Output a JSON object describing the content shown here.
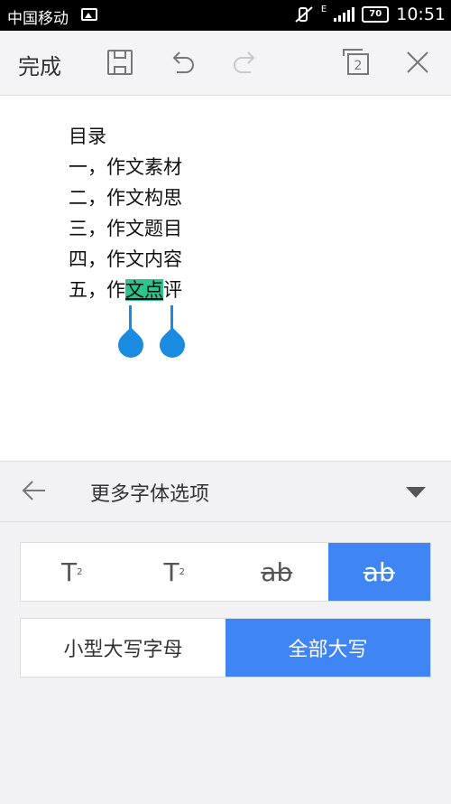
{
  "status_bar": {
    "carrier": "中国移动",
    "network": "E",
    "battery": "70",
    "time": "10:51"
  },
  "toolbar": {
    "done_label": "完成",
    "page_count": "2"
  },
  "document": {
    "lines": [
      {
        "text": "目录"
      },
      {
        "text": "一，作文素材"
      },
      {
        "text": "二，作文构思"
      },
      {
        "text": "三，作文题目"
      },
      {
        "text": "四，作文内容"
      }
    ],
    "last_line": {
      "before": "五，作",
      "selected": "文点",
      "after": "评"
    }
  },
  "font_options": {
    "title": "更多字体选项",
    "row1": [
      {
        "main": "T",
        "mark": "2",
        "kind": "superscript"
      },
      {
        "main": "T",
        "mark": "2",
        "kind": "subscript"
      },
      {
        "main": "ab",
        "kind": "strikethrough"
      },
      {
        "main": "ab",
        "kind": "double-strikethrough",
        "active": true
      }
    ],
    "row2": [
      {
        "label": "小型大写字母"
      },
      {
        "label": "全部大写",
        "active": true
      }
    ]
  },
  "colors": {
    "accent": "#3f85f4",
    "selection": "#2bc48a",
    "handle": "#1a8be0"
  }
}
